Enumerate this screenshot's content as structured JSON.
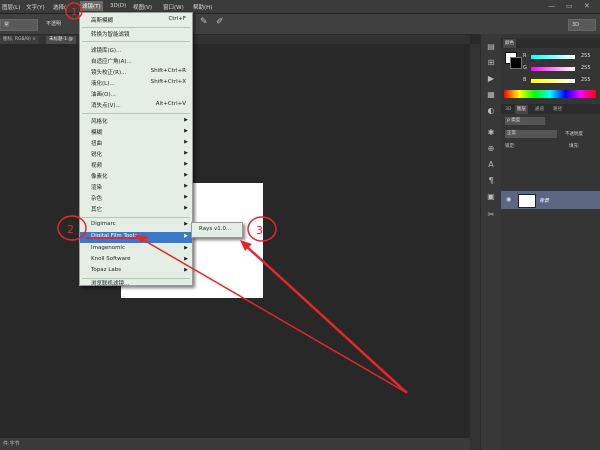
{
  "menubar": {
    "items": [
      "图层(L)",
      "文字(Y)",
      "选择(",
      "滤镜(T)",
      "3D(D)",
      "视图(V)",
      "窗口(W)",
      "帮助(H)"
    ],
    "window_controls": [
      "—",
      "▭",
      "✕"
    ]
  },
  "options": {
    "preset": "常",
    "dropdown": "不透明",
    "mode3d": "3D"
  },
  "tabs": {
    "doc1": "图标, RGB/8) ×",
    "doc2": "未标题-1 @"
  },
  "status": {
    "text": "件:字节"
  },
  "filter_menu": {
    "items": [
      {
        "label": "高斯模糊",
        "shortcut": "Ctrl+F"
      },
      {
        "label": "转换为智能滤镜"
      },
      {
        "label": "滤镜库(G)..."
      },
      {
        "label": "自适应广角(A)..."
      },
      {
        "label": "镜头校正(R)...",
        "shortcut": "Shift+Ctrl+R"
      },
      {
        "label": "液化(L)...",
        "shortcut": "Shift+Ctrl+X"
      },
      {
        "label": "油画(O)..."
      },
      {
        "label": "消失点(V)...",
        "shortcut": "Alt+Ctrl+V"
      },
      {
        "label": "风格化"
      },
      {
        "label": "模糊"
      },
      {
        "label": "扭曲"
      },
      {
        "label": "锐化"
      },
      {
        "label": "视频"
      },
      {
        "label": "像素化"
      },
      {
        "label": "渲染"
      },
      {
        "label": "杂色"
      },
      {
        "label": "其它"
      },
      {
        "label": "Digimarc"
      },
      {
        "label": "Digital Film Tools"
      },
      {
        "label": "Imagenomic"
      },
      {
        "label": "Knoll Software"
      },
      {
        "label": "Topaz Labs"
      },
      {
        "label": "浏览联机滤镜..."
      }
    ]
  },
  "submenu": {
    "item": "Rays v1.0..."
  },
  "annotations": {
    "n1": "1",
    "n2": "2",
    "n3": "3"
  },
  "panels": {
    "color_tabs": [
      "颜色"
    ],
    "sliders": [
      {
        "label": "R",
        "value": "255"
      },
      {
        "label": "G",
        "value": "255"
      },
      {
        "label": "B",
        "value": "255"
      }
    ],
    "layer_tabs": [
      "3D",
      "图层",
      "通道",
      "路径"
    ],
    "kind": "ρ 类型",
    "blend": "正常",
    "opacity": "不透明度",
    "lock": "锁定:",
    "fill": "填充:",
    "layer_name": "背景"
  },
  "colors": {
    "accent": "#3a78c8",
    "menu_bg": "#e4eee4",
    "annotation": "#e8262a"
  }
}
